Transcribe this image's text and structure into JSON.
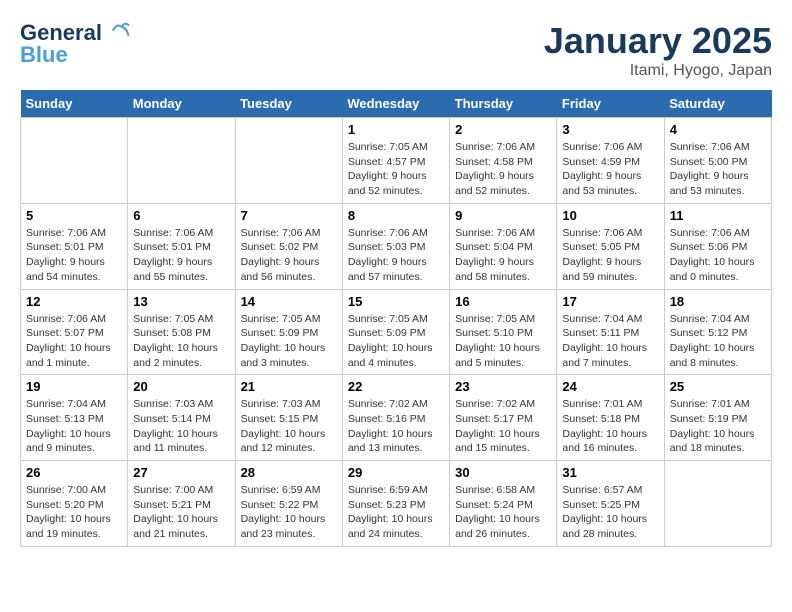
{
  "header": {
    "logo_line1": "General",
    "logo_line2": "Blue",
    "month": "January 2025",
    "location": "Itami, Hyogo, Japan"
  },
  "weekdays": [
    "Sunday",
    "Monday",
    "Tuesday",
    "Wednesday",
    "Thursday",
    "Friday",
    "Saturday"
  ],
  "weeks": [
    [
      {
        "day": null
      },
      {
        "day": null
      },
      {
        "day": null
      },
      {
        "day": 1,
        "sunrise": "7:05 AM",
        "sunset": "4:57 PM",
        "daylight": "Daylight: 9 hours and 52 minutes."
      },
      {
        "day": 2,
        "sunrise": "7:06 AM",
        "sunset": "4:58 PM",
        "daylight": "Daylight: 9 hours and 52 minutes."
      },
      {
        "day": 3,
        "sunrise": "7:06 AM",
        "sunset": "4:59 PM",
        "daylight": "Daylight: 9 hours and 53 minutes."
      },
      {
        "day": 4,
        "sunrise": "7:06 AM",
        "sunset": "5:00 PM",
        "daylight": "Daylight: 9 hours and 53 minutes."
      }
    ],
    [
      {
        "day": 5,
        "sunrise": "7:06 AM",
        "sunset": "5:01 PM",
        "daylight": "Daylight: 9 hours and 54 minutes."
      },
      {
        "day": 6,
        "sunrise": "7:06 AM",
        "sunset": "5:01 PM",
        "daylight": "Daylight: 9 hours and 55 minutes."
      },
      {
        "day": 7,
        "sunrise": "7:06 AM",
        "sunset": "5:02 PM",
        "daylight": "Daylight: 9 hours and 56 minutes."
      },
      {
        "day": 8,
        "sunrise": "7:06 AM",
        "sunset": "5:03 PM",
        "daylight": "Daylight: 9 hours and 57 minutes."
      },
      {
        "day": 9,
        "sunrise": "7:06 AM",
        "sunset": "5:04 PM",
        "daylight": "Daylight: 9 hours and 58 minutes."
      },
      {
        "day": 10,
        "sunrise": "7:06 AM",
        "sunset": "5:05 PM",
        "daylight": "Daylight: 9 hours and 59 minutes."
      },
      {
        "day": 11,
        "sunrise": "7:06 AM",
        "sunset": "5:06 PM",
        "daylight": "Daylight: 10 hours and 0 minutes."
      }
    ],
    [
      {
        "day": 12,
        "sunrise": "7:06 AM",
        "sunset": "5:07 PM",
        "daylight": "Daylight: 10 hours and 1 minute."
      },
      {
        "day": 13,
        "sunrise": "7:05 AM",
        "sunset": "5:08 PM",
        "daylight": "Daylight: 10 hours and 2 minutes."
      },
      {
        "day": 14,
        "sunrise": "7:05 AM",
        "sunset": "5:09 PM",
        "daylight": "Daylight: 10 hours and 3 minutes."
      },
      {
        "day": 15,
        "sunrise": "7:05 AM",
        "sunset": "5:09 PM",
        "daylight": "Daylight: 10 hours and 4 minutes."
      },
      {
        "day": 16,
        "sunrise": "7:05 AM",
        "sunset": "5:10 PM",
        "daylight": "Daylight: 10 hours and 5 minutes."
      },
      {
        "day": 17,
        "sunrise": "7:04 AM",
        "sunset": "5:11 PM",
        "daylight": "Daylight: 10 hours and 7 minutes."
      },
      {
        "day": 18,
        "sunrise": "7:04 AM",
        "sunset": "5:12 PM",
        "daylight": "Daylight: 10 hours and 8 minutes."
      }
    ],
    [
      {
        "day": 19,
        "sunrise": "7:04 AM",
        "sunset": "5:13 PM",
        "daylight": "Daylight: 10 hours and 9 minutes."
      },
      {
        "day": 20,
        "sunrise": "7:03 AM",
        "sunset": "5:14 PM",
        "daylight": "Daylight: 10 hours and 11 minutes."
      },
      {
        "day": 21,
        "sunrise": "7:03 AM",
        "sunset": "5:15 PM",
        "daylight": "Daylight: 10 hours and 12 minutes."
      },
      {
        "day": 22,
        "sunrise": "7:02 AM",
        "sunset": "5:16 PM",
        "daylight": "Daylight: 10 hours and 13 minutes."
      },
      {
        "day": 23,
        "sunrise": "7:02 AM",
        "sunset": "5:17 PM",
        "daylight": "Daylight: 10 hours and 15 minutes."
      },
      {
        "day": 24,
        "sunrise": "7:01 AM",
        "sunset": "5:18 PM",
        "daylight": "Daylight: 10 hours and 16 minutes."
      },
      {
        "day": 25,
        "sunrise": "7:01 AM",
        "sunset": "5:19 PM",
        "daylight": "Daylight: 10 hours and 18 minutes."
      }
    ],
    [
      {
        "day": 26,
        "sunrise": "7:00 AM",
        "sunset": "5:20 PM",
        "daylight": "Daylight: 10 hours and 19 minutes."
      },
      {
        "day": 27,
        "sunrise": "7:00 AM",
        "sunset": "5:21 PM",
        "daylight": "Daylight: 10 hours and 21 minutes."
      },
      {
        "day": 28,
        "sunrise": "6:59 AM",
        "sunset": "5:22 PM",
        "daylight": "Daylight: 10 hours and 23 minutes."
      },
      {
        "day": 29,
        "sunrise": "6:59 AM",
        "sunset": "5:23 PM",
        "daylight": "Daylight: 10 hours and 24 minutes."
      },
      {
        "day": 30,
        "sunrise": "6:58 AM",
        "sunset": "5:24 PM",
        "daylight": "Daylight: 10 hours and 26 minutes."
      },
      {
        "day": 31,
        "sunrise": "6:57 AM",
        "sunset": "5:25 PM",
        "daylight": "Daylight: 10 hours and 28 minutes."
      },
      {
        "day": null
      }
    ]
  ]
}
